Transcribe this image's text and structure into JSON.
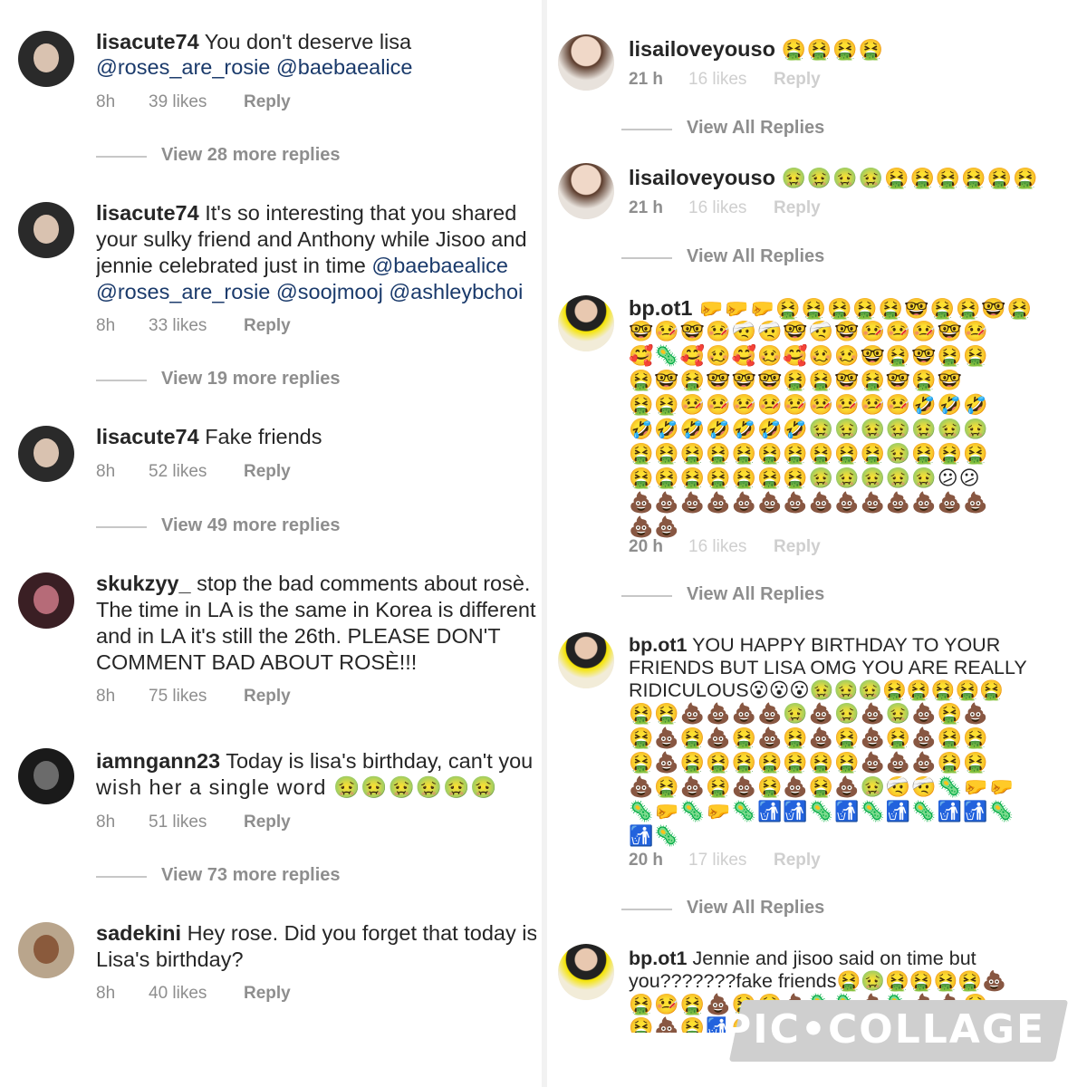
{
  "left": {
    "comments": [
      {
        "username": "lisacute74",
        "lines": [
          "You don't deserve lisa"
        ],
        "mentions_line": "@roses_are_rosie @baebaealice",
        "time": "8h",
        "likes": "39 likes",
        "reply": "Reply",
        "view_more": "View 28 more replies"
      },
      {
        "username": "lisacute74",
        "lines": [
          "It's so interesting that you shared",
          "your sulky friend and Anthony while Jisoo and",
          "jennie celebrated just in time "
        ],
        "mention_inline": "@baebaealice",
        "mentions_line": "@roses_are_rosie @soojmooj @ashleybchoi",
        "time": "8h",
        "likes": "33 likes",
        "reply": "Reply",
        "view_more": "View 19 more replies"
      },
      {
        "username": "lisacute74",
        "lines": [
          "Fake friends"
        ],
        "time": "8h",
        "likes": "52 likes",
        "reply": "Reply",
        "view_more": "View 49 more replies"
      },
      {
        "username": "skukzyy_",
        "lines": [
          "stop the bad comments about rosè.",
          "The time in LA is the same in Korea is different",
          "and in LA it's still the 26th. PLEASE DON'T",
          "COMMENT BAD ABOUT ROSÈ!!!"
        ],
        "time": "8h",
        "likes": "75 likes",
        "reply": "Reply"
      },
      {
        "username": "iamngann23",
        "lines": [
          "Today is lisa's birthday, can't you",
          "wish her a single word 🤢🤢🤢🤢🤢🤢"
        ],
        "time": "8h",
        "likes": "51 likes",
        "reply": "Reply",
        "view_more": "View 73 more replies"
      },
      {
        "username": "sadekini",
        "lines": [
          "Hey rose. Did you forget that today is",
          "Lisa's  birthday?"
        ],
        "time": "8h",
        "likes": "40 likes",
        "reply": "Reply"
      }
    ]
  },
  "right": {
    "comments": [
      {
        "username": "lisailoveyouso",
        "text": "🤮🤮🤮🤮",
        "time": "21 h",
        "likes": "16 likes",
        "reply": "Reply",
        "view_all": "View All Replies"
      },
      {
        "username": "lisailoveyouso",
        "text": "🤢🤢🤢🤢🤮🤮🤮🤮🤮🤮",
        "time": "21 h",
        "likes": "16 likes",
        "reply": "Reply",
        "view_all": "View All Replies"
      },
      {
        "username": "bp.ot1",
        "text": "",
        "emoji_lines": [
          "🤛🤛🤛🤮🤮🤮🤮🤮🤓🤮🤮🤓🤮",
          "🤓🤒🤓🤒🤕🤕🤓🤕🤓🤒🤒🤒🤓🤒",
          "🥰🦠🥰🥴🥰🥴🥰🥴🥴🤓🤮🤓🤮🤮",
          "🤮🤓🤮🤓🤓🤓🤮🤮🤓🤮🤓🤮🤓",
          "🤮🤮🤒🤒🤒🤒🤒🤒🤒🤒🤒🤣🤣🤣",
          "🤣🤣🤣🤣🤣🤣🤣🤢🤢🤢🤢🤢🤢🤢",
          "🤮🤮🤮🤮🤮🤮🤮🤮🤮🤮🤢🤮🤮🤮",
          "🤮🤮🤮🤮🤮🤮🤮🤢🤢🤢🤢🤢😕😕",
          "💩💩💩💩💩💩💩💩💩💩💩💩💩💩",
          "💩💩"
        ],
        "time": "20 h",
        "likes": "16 likes",
        "reply": "Reply",
        "view_all": "View All Replies"
      },
      {
        "username": "bp.ot1",
        "text": "YOU HAPPY BIRTHDAY TO YOUR",
        "lines": [
          "FRIENDS BUT LISA OMG YOU ARE REALLY",
          "RIDICULOUS😮😮😮🤢🤢🤢🤮🤮🤮🤮🤮"
        ],
        "emoji_lines": [
          "🤮🤮💩💩💩💩🤢💩🤢💩🤢💩🤮💩",
          "🤮💩🤮💩🤮💩🤮💩🤮💩🤮💩🤮🤮",
          "🤮💩🤮🤮🤮🤮🤮🤮🤮💩💩💩🤮🤮",
          "💩🤮💩🤮💩🤮💩🤮💩🤢🤕🤕🦠🤛🤛",
          "🦠🤛🦠🤛🦠🚮🚮🦠🚮🦠🚮🦠🚮🚮🦠",
          "🚮🦠"
        ],
        "time": "20 h",
        "likes": "17 likes",
        "reply": "Reply",
        "view_all": "View All Replies"
      },
      {
        "username": "bp.ot1",
        "text": "Jennie and jisoo said on time but",
        "lines": [
          "you???????fake friends🤮🤢🤮🤮🤮🤮💩"
        ],
        "emoji_lines": [
          "🤮🤒🤮💩🤮🤮💩🦠🦠💩🦠💩💩🤮",
          "🤮💩🤮🚮🤮🤮💩🤮🤮🤮🤮🤮🤮"
        ]
      }
    ]
  },
  "watermark": "PIC•COLLAGE",
  "colors": {
    "mention": "#1a3a6b",
    "meta": "#8e8e8e",
    "text": "#262626"
  }
}
